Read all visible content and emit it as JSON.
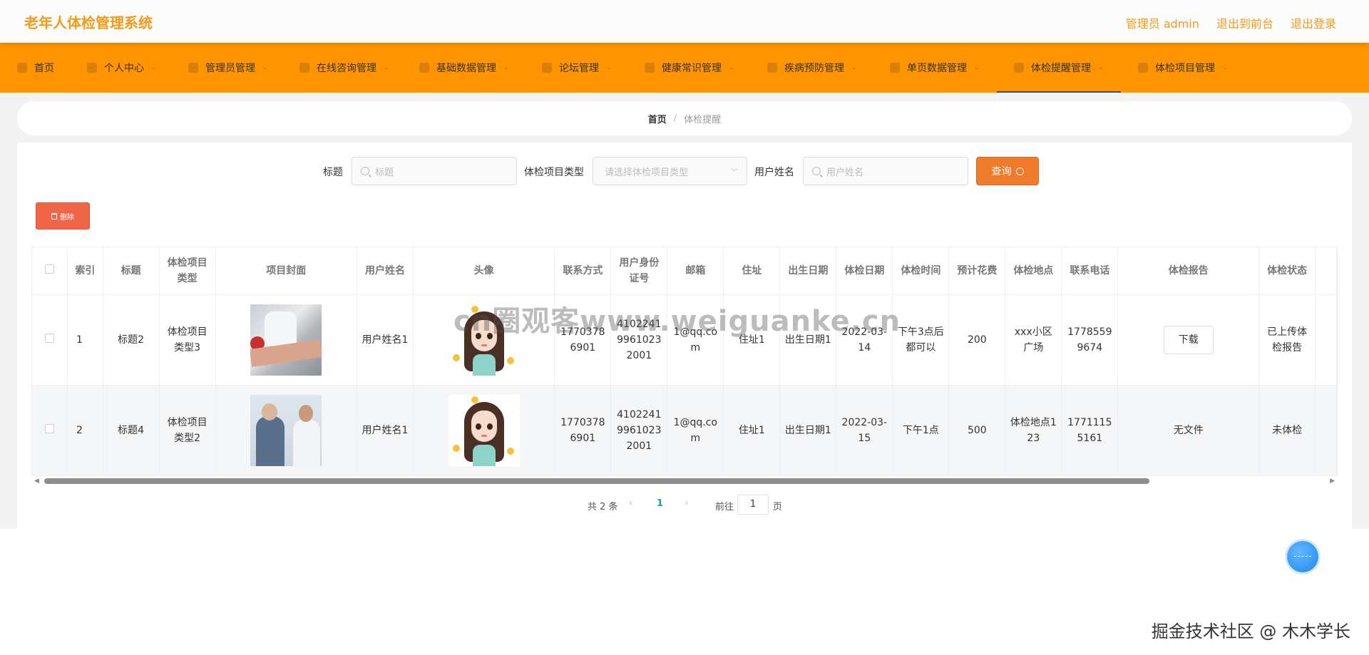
{
  "header": {
    "title": "老年人体检管理系统",
    "links": [
      "管理员 admin",
      "退出到前台",
      "退出登录"
    ]
  },
  "nav": {
    "items": [
      {
        "label": "首页",
        "icon": "home-icon"
      },
      {
        "label": "个人中心",
        "icon": "user-icon"
      },
      {
        "label": "管理员管理",
        "icon": "admin-icon"
      },
      {
        "label": "在线咨询管理",
        "icon": "chat-icon"
      },
      {
        "label": "基础数据管理",
        "icon": "data-icon"
      },
      {
        "label": "论坛管理",
        "icon": "forum-icon"
      },
      {
        "label": "健康常识管理",
        "icon": "health-icon"
      },
      {
        "label": "疾病预防管理",
        "icon": "prevent-icon"
      },
      {
        "label": "单页数据管理",
        "icon": "page-icon"
      },
      {
        "label": "体检提醒管理",
        "icon": "mail-icon"
      },
      {
        "label": "体检项目管理",
        "icon": "project-icon"
      }
    ],
    "active_index": 9
  },
  "breadcrumb": {
    "home": "首页",
    "separator": "/",
    "current": "体检提醒"
  },
  "search": {
    "title_label": "标题",
    "title_placeholder": "标题",
    "type_label": "体检项目类型",
    "type_placeholder": "请选择体检项目类型",
    "username_label": "用户姓名",
    "username_placeholder": "用户姓名",
    "query_label": "查询"
  },
  "actions": {
    "delete_label": "删除"
  },
  "table": {
    "headers": [
      "索引",
      "标题",
      "体检项目类型",
      "项目封面",
      "用户姓名",
      "头像",
      "联系方式",
      "用户身份证号",
      "邮箱",
      "住址",
      "出生日期",
      "体检日期",
      "体检时间",
      "预计花费",
      "体检地点",
      "联系电话",
      "体检报告",
      "体检状态"
    ],
    "rows": [
      {
        "index": "1",
        "title": "标题2",
        "type": "体检项目类型3",
        "username": "用户姓名1",
        "contact": "17703786901",
        "id_card": "410224199610232001",
        "email": "1@qq.com",
        "address": "住址1",
        "birth": "出生日期1",
        "exam_date": "2022-03-14",
        "exam_time": "下午3点后都可以",
        "cost": "200",
        "location": "xxx小区广场",
        "phone": "17785599674",
        "report": "下载",
        "status": "已上传体检报告"
      },
      {
        "index": "2",
        "title": "标题4",
        "type": "体检项目类型2",
        "username": "用户姓名1",
        "contact": "17703786901",
        "id_card": "410224199610232001",
        "email": "1@qq.com",
        "address": "住址1",
        "birth": "出生日期1",
        "exam_date": "2022-03-15",
        "exam_time": "下午1点",
        "cost": "500",
        "location": "体检地点123",
        "phone": "17711155161",
        "report": "无文件",
        "status": "未体检"
      }
    ]
  },
  "pagination": {
    "total": "共 2 条",
    "current": "1",
    "goto_label": "前往",
    "goto_value": "1",
    "page_suffix": "页"
  },
  "watermarks": {
    "middle": "cn圈观客www.weiguanke.cn",
    "bottom": "掘金技术社区 @ 木木学长"
  },
  "colors": {
    "accent": "#f39a18",
    "nav_bg": "#ff9400",
    "query_btn": "#ef7a2a",
    "delete_btn": "#ef6548",
    "pager_active": "#1aa094"
  }
}
